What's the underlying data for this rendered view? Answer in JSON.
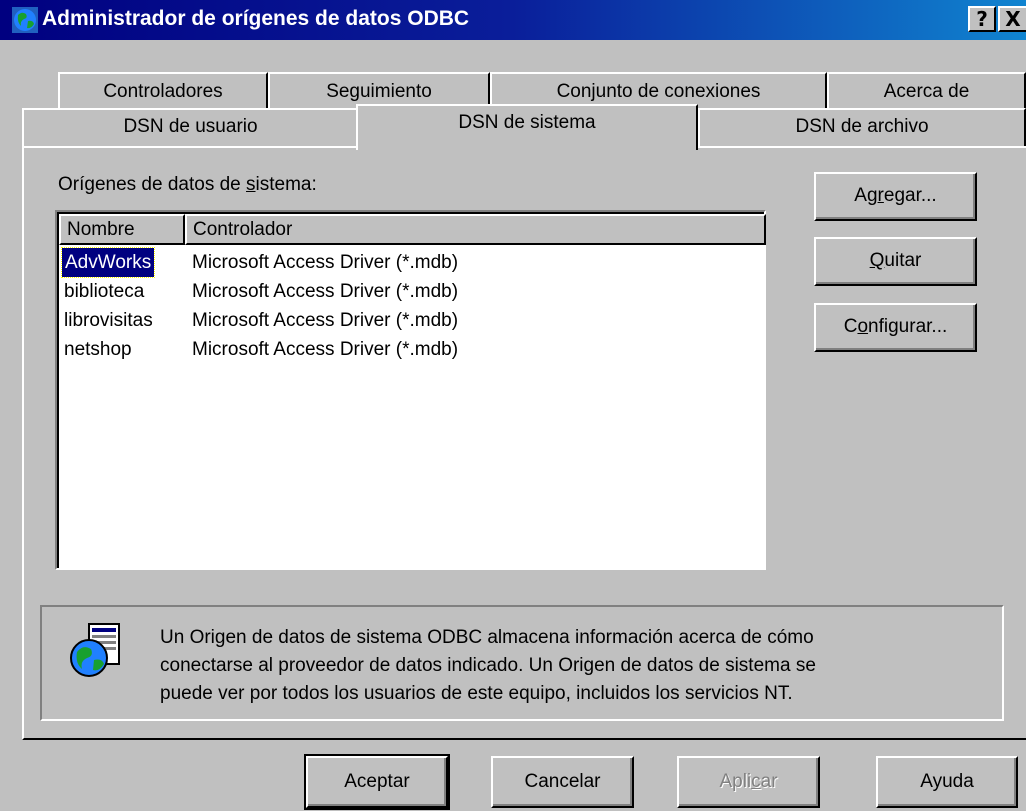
{
  "window": {
    "title": "Administrador de orígenes de datos ODBC",
    "icon": "odbc-globe-icon",
    "help_button": "?",
    "close_button": "X"
  },
  "tabs": {
    "row1": [
      "Controladores",
      "Seguimiento",
      "Conjunto de conexiones",
      "Acerca de"
    ],
    "row2": [
      "DSN de usuario",
      "DSN de sistema",
      "DSN de archivo"
    ],
    "active": "DSN de sistema"
  },
  "panel": {
    "section_label_pre": "Orígenes de datos de ",
    "section_label_ul": "s",
    "section_label_post": "istema:",
    "columns": [
      "Nombre",
      "Controlador"
    ],
    "rows": [
      {
        "name": "AdvWorks",
        "driver": "Microsoft Access Driver (*.mdb)",
        "selected": true
      },
      {
        "name": "biblioteca",
        "driver": "Microsoft Access Driver (*.mdb)",
        "selected": false
      },
      {
        "name": "librovisitas",
        "driver": "Microsoft Access Driver (*.mdb)",
        "selected": false
      },
      {
        "name": "netshop",
        "driver": "Microsoft Access Driver (*.mdb)",
        "selected": false
      }
    ],
    "buttons": {
      "add": {
        "pre": "Ag",
        "ul": "r",
        "post": "egar..."
      },
      "remove": {
        "pre": "",
        "ul": "Q",
        "post": "uitar"
      },
      "configure": {
        "pre": "C",
        "ul": "o",
        "post": "nfigurar..."
      }
    },
    "info_text": [
      "Un Origen de datos de sistema ODBC almacena información acerca de cómo",
      "conectarse al proveedor de datos indicado. Un Origen de datos de sistema se",
      "puede ver por todos los usuarios de este equipo, incluidos los servicios NT."
    ],
    "info_icon": "database-globe-icon"
  },
  "footer": {
    "ok": "Aceptar",
    "cancel": "Cancelar",
    "apply_pre": "Apli",
    "apply_ul": "c",
    "apply_post": "ar",
    "help": "Ayuda"
  },
  "colors": {
    "titlebar_start": "#000080",
    "titlebar_end": "#1084d0",
    "face": "#c0c0c0",
    "selection": "#000080"
  }
}
